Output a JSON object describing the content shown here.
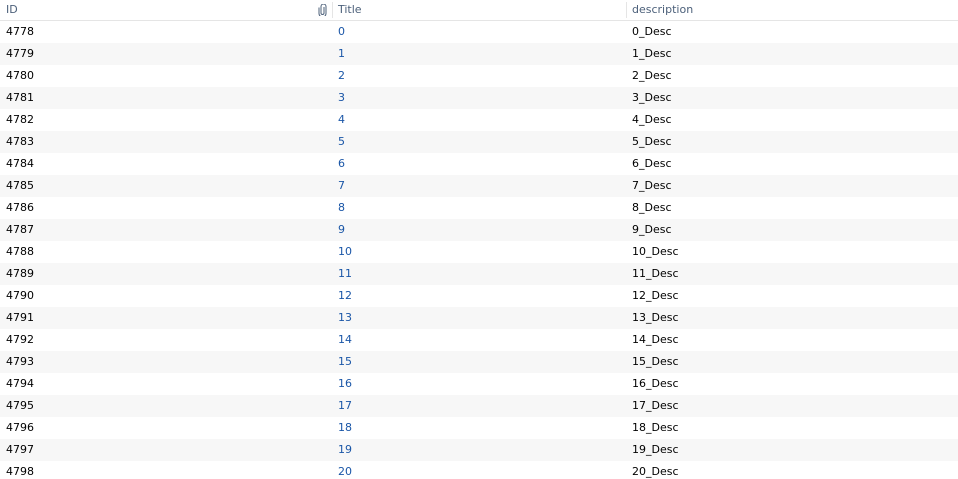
{
  "header": {
    "id": "ID",
    "attachment_icon": "paperclip-icon",
    "title": "Title",
    "description": "description"
  },
  "rows": [
    {
      "id": "4778",
      "title": "0",
      "description": "0_Desc"
    },
    {
      "id": "4779",
      "title": "1",
      "description": "1_Desc"
    },
    {
      "id": "4780",
      "title": "2",
      "description": "2_Desc"
    },
    {
      "id": "4781",
      "title": "3",
      "description": "3_Desc"
    },
    {
      "id": "4782",
      "title": "4",
      "description": "4_Desc"
    },
    {
      "id": "4783",
      "title": "5",
      "description": "5_Desc"
    },
    {
      "id": "4784",
      "title": "6",
      "description": "6_Desc"
    },
    {
      "id": "4785",
      "title": "7",
      "description": "7_Desc"
    },
    {
      "id": "4786",
      "title": "8",
      "description": "8_Desc"
    },
    {
      "id": "4787",
      "title": "9",
      "description": "9_Desc"
    },
    {
      "id": "4788",
      "title": "10",
      "description": "10_Desc"
    },
    {
      "id": "4789",
      "title": "11",
      "description": "11_Desc"
    },
    {
      "id": "4790",
      "title": "12",
      "description": "12_Desc"
    },
    {
      "id": "4791",
      "title": "13",
      "description": "13_Desc"
    },
    {
      "id": "4792",
      "title": "14",
      "description": "14_Desc"
    },
    {
      "id": "4793",
      "title": "15",
      "description": "15_Desc"
    },
    {
      "id": "4794",
      "title": "16",
      "description": "16_Desc"
    },
    {
      "id": "4795",
      "title": "17",
      "description": "17_Desc"
    },
    {
      "id": "4796",
      "title": "18",
      "description": "18_Desc"
    },
    {
      "id": "4797",
      "title": "19",
      "description": "19_Desc"
    },
    {
      "id": "4798",
      "title": "20",
      "description": "20_Desc"
    }
  ],
  "colors": {
    "header_text": "#4c607a",
    "link_text": "#1a56a7",
    "alt_row": "#f7f7f7",
    "border": "#e5e5e5"
  }
}
